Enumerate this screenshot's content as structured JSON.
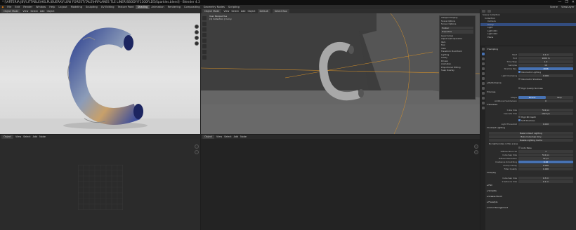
{
  "window": {
    "title": "* [\\ARTERIA JB\\FLITTABLE\\HELPL\\BUERA\\FLOW FOREST\\TALE\\HRPLANES TLE LINER\\SBODY\\F1100FLD5\\Sparkles.blend] - Blender 4.3",
    "controls": [
      "—",
      "❐",
      "✕"
    ]
  },
  "menubar": {
    "logo": "◆",
    "menus": [
      "File",
      "Edit",
      "Render",
      "Window",
      "Help"
    ],
    "tabs": [
      "Layout",
      "Modeling",
      "Sculpting",
      "UV Editing",
      "Texture Paint",
      "Shading",
      "Animation",
      "Rendering",
      "Compositing",
      "Geometry Nodes",
      "Scripting"
    ],
    "active_tab": "Shading",
    "scene_label": "Scene",
    "viewlayer_label": "ViewLayer"
  },
  "viewport_render": {
    "header": [
      "Object Mode",
      "View",
      "Select",
      "Add",
      "Object"
    ]
  },
  "viewport_main": {
    "header": [
      "Object Mode",
      "View",
      "Select",
      "Add",
      "Object"
    ],
    "shading": "Default",
    "select": "Select Box",
    "overlay_text": [
      "User Perspective",
      "(1) Collection | Curvy"
    ],
    "npanel": {
      "rows": [
        "Viewport Display",
        "Scene Options",
        "Screen Options",
        "Toolbar",
        "Properties",
        "Layer Group",
        "Adjust Last Operation",
        "Item",
        "Tool",
        "View",
        "Transform Pivot Point",
        "Lighting",
        "Cavity",
        "Drivers",
        "Animation",
        "Proportional Editing",
        "Snap Overlay"
      ]
    }
  },
  "bottom_left": {
    "header": [
      "Object",
      "View",
      "Select",
      "Add",
      "Node"
    ]
  },
  "bottom_mid": {
    "header": [
      "Object",
      "View",
      "Select",
      "Add",
      "Node"
    ]
  },
  "outliner": {
    "title": "Scene Collection",
    "rows": [
      "Collection",
      "Camera",
      "Curvy",
      "Light",
      "Light.001",
      "Light.002",
      "Plane"
    ],
    "selected": "Curvy"
  },
  "properties": {
    "sections": [
      {
        "type": "sec",
        "label": "▾ Sampling"
      },
      {
        "type": "field",
        "label": "Start",
        "value": "0.1 m"
      },
      {
        "type": "field",
        "label": "End",
        "value": "1000 m"
      },
      {
        "type": "field",
        "label": "Time Step",
        "value": "1.0"
      },
      {
        "type": "field",
        "label": "Samples",
        "value": "16"
      },
      {
        "type": "field",
        "label": "Shadow Res.",
        "value": "4096",
        "blue": true
      },
      {
        "type": "check",
        "label": "Volumetric Lighting",
        "on": true
      },
      {
        "type": "field",
        "label": "Light Clamping",
        "value": "0.000"
      },
      {
        "type": "check",
        "label": "Volumetric Shadows",
        "on": false
      },
      {
        "type": "sec",
        "label": "▸ Performance"
      },
      {
        "type": "check",
        "label": "High Quality Normals",
        "on": false
      },
      {
        "type": "sec",
        "label": "▾ Curves"
      },
      {
        "type": "toggle",
        "label": "Shape",
        "a": "Strand",
        "b": "Strip"
      },
      {
        "type": "field",
        "label": "Additional Subdivision",
        "value": "0"
      },
      {
        "type": "sec",
        "label": "▾ Shadows"
      },
      {
        "type": "field",
        "label": "Cube Size",
        "value": "512 px"
      },
      {
        "type": "field",
        "label": "Cascade Size",
        "value": "1024 px"
      },
      {
        "type": "check",
        "label": "High Bit Depth",
        "on": false
      },
      {
        "type": "check",
        "label": "Soft Shadows",
        "on": true
      },
      {
        "type": "field",
        "label": "Light Threshold",
        "value": "0.010"
      },
      {
        "type": "sec",
        "label": "▾ Indirect Lighting"
      },
      {
        "type": "button",
        "label": "Bake Indirect Lighting"
      },
      {
        "type": "button",
        "label": "Bake Cubemap Only"
      },
      {
        "type": "button",
        "label": "Delete Lighting Cache"
      },
      {
        "type": "text",
        "label": "No light probes in this scene"
      },
      {
        "type": "check",
        "label": "Auto Bake",
        "on": false
      },
      {
        "type": "field",
        "label": "Diffuse Bounces",
        "value": "3"
      },
      {
        "type": "field",
        "label": "Cubemap Size",
        "value": "512 px"
      },
      {
        "type": "field",
        "label": "Diffuse Resolution",
        "value": "32 px"
      },
      {
        "type": "field",
        "label": "Irradiance Smoothing",
        "value": "0.10",
        "blue": true
      },
      {
        "type": "field",
        "label": "Clamp Glossy",
        "value": "0.000"
      },
      {
        "type": "field",
        "label": "Filter Quality",
        "value": "1.000"
      },
      {
        "type": "sec",
        "label": "▾ Display"
      },
      {
        "type": "field",
        "label": "Cubemap Size",
        "value": "0.3 m"
      },
      {
        "type": "field",
        "label": "Irradiance Size",
        "value": "0.1 m"
      },
      {
        "type": "sec",
        "label": "▸ Film"
      },
      {
        "type": "sec",
        "label": "▸ Simplify"
      },
      {
        "type": "sec",
        "label": "▸ Grease Pencil"
      },
      {
        "type": "sec",
        "label": "▸ Freestyle"
      },
      {
        "type": "sec",
        "label": "▸ Color Management"
      }
    ]
  }
}
